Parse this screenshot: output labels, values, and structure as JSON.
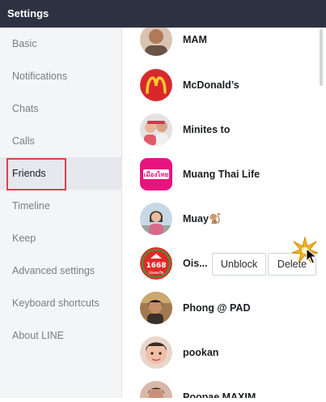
{
  "window": {
    "title": "Settings"
  },
  "sidebar": {
    "items": [
      {
        "label": "Basic"
      },
      {
        "label": "Notifications"
      },
      {
        "label": "Chats"
      },
      {
        "label": "Calls"
      },
      {
        "label": "Friends",
        "active": true
      },
      {
        "label": "Timeline"
      },
      {
        "label": "Keep"
      },
      {
        "label": "Advanced settings"
      },
      {
        "label": "Keyboard shortcuts"
      },
      {
        "label": "About LINE"
      }
    ]
  },
  "friends": [
    {
      "name": "MAM",
      "avatar": "person-photo"
    },
    {
      "name": "McDonald’s",
      "avatar": "mcdonalds-logo"
    },
    {
      "name": "Minites to",
      "avatar": "people-photo"
    },
    {
      "name": "Muang Thai Life",
      "avatar": "muang-thai-logo",
      "logo_text": "เมืองไทย"
    },
    {
      "name": "Muay🐒",
      "avatar": "person-photo"
    },
    {
      "name": "Ois...",
      "avatar": "1668-logo",
      "logo_text": "1668",
      "logo_subtext": "ปลอดภัย",
      "actions": {
        "unblock": "Unblock",
        "delete": "Delete"
      }
    },
    {
      "name": "Phong @ PAD",
      "avatar": "person-photo"
    },
    {
      "name": "pookan",
      "avatar": "person-photo"
    },
    {
      "name": "Poopae MAXIM",
      "avatar": "person-photo"
    }
  ],
  "colors": {
    "titlebar": "#2d3242",
    "sidebar_bg": "#f4f5f7",
    "active_item_bg": "#e6e8ee",
    "highlight": "#e0404a",
    "mcdonalds_red": "#d8282d",
    "mcdonalds_yellow": "#ffc72c",
    "muang_thai_pink": "#e8137f",
    "logo_1668_red": "#e02a26"
  }
}
